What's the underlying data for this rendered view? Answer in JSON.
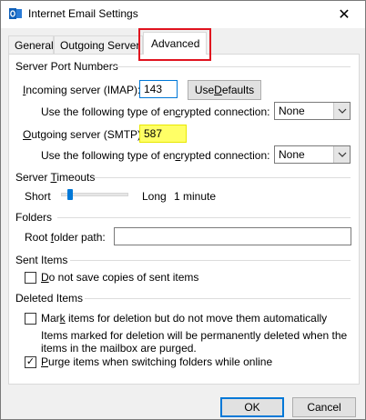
{
  "window": {
    "title": "Internet Email Settings",
    "close_glyph": "✕"
  },
  "tabs": [
    {
      "label": "General"
    },
    {
      "label": "Outgoing Server"
    },
    {
      "label": "Advanced"
    }
  ],
  "server_ports": {
    "heading": "Server Port Numbers",
    "incoming_label_pre": "",
    "incoming_label_u": "I",
    "incoming_label_post": "ncoming server (IMAP):",
    "incoming_value": "143",
    "use_defaults_pre": "Use ",
    "use_defaults_u": "D",
    "use_defaults_post": "efaults",
    "enc_label_1_pre": "Use the following type of en",
    "enc_label_1_u": "c",
    "enc_label_1_post": "rypted connection:",
    "enc_value_1": "None",
    "outgoing_label_pre": "",
    "outgoing_label_u": "O",
    "outgoing_label_post": "utgoing server (SMTP):",
    "outgoing_value": "587",
    "enc_label_2_pre": "Use the following type of en",
    "enc_label_2_u": "c",
    "enc_label_2_post": "rypted connection:",
    "enc_value_2": "None"
  },
  "timeouts": {
    "heading_pre": "Server ",
    "heading_u": "T",
    "heading_post": "imeouts",
    "short_label": "Short",
    "long_label": "Long",
    "value_label": "1 minute",
    "slider_level": 0.1
  },
  "folders": {
    "heading": "Folders",
    "root_label_pre": "Root ",
    "root_label_u": "f",
    "root_label_post": "older path:",
    "root_value": ""
  },
  "sent_items": {
    "heading": "Sent Items",
    "option_pre": "",
    "option_u": "D",
    "option_post": "o not save copies of sent items",
    "checked": false
  },
  "deleted_items": {
    "heading": "Deleted Items",
    "mark_pre": "Mar",
    "mark_u": "k",
    "mark_post": " items for deletion but do not move them automatically",
    "mark_checked": false,
    "note_line1": "Items marked for deletion will be permanently deleted when the",
    "note_line2": "items in the mailbox are purged.",
    "purge_pre": "",
    "purge_u": "P",
    "purge_post": "urge items when switching folders while online",
    "purge_checked": true,
    "check_glyph": "✓"
  },
  "footer": {
    "ok_label": "OK",
    "cancel_label": "Cancel"
  },
  "colors": {
    "highlight_red": "#e0131f",
    "yellow_field": "#ffff66",
    "accent_blue": "#0078d7"
  }
}
